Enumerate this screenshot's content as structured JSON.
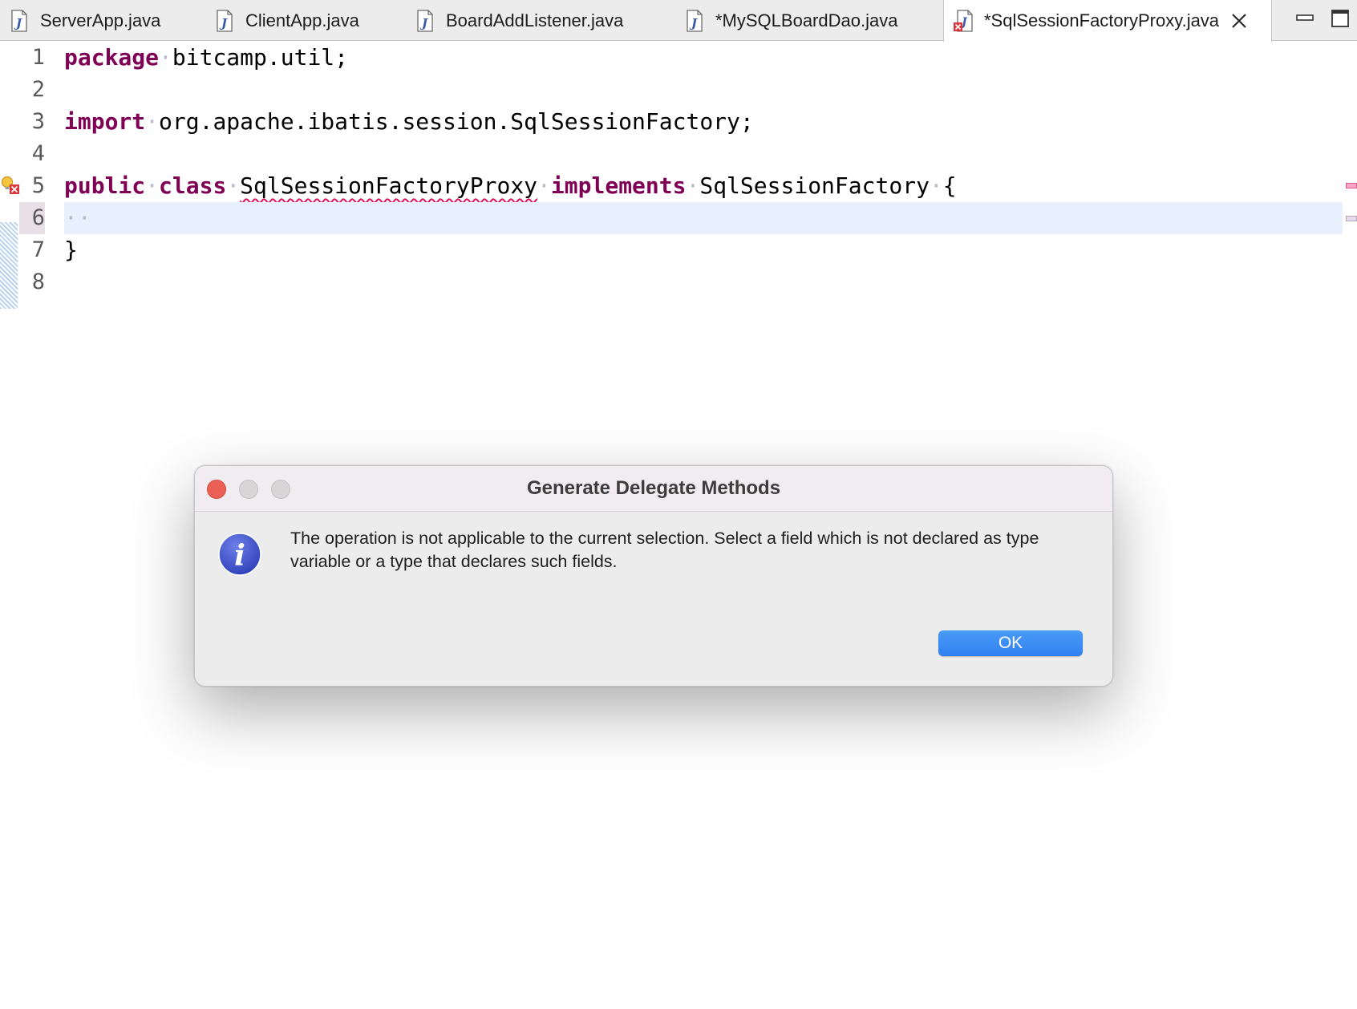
{
  "tabs": [
    {
      "label": "ServerApp.java",
      "icon": "java-file-icon",
      "active": false
    },
    {
      "label": "ClientApp.java",
      "icon": "java-file-icon",
      "active": false
    },
    {
      "label": "BoardAddListener.java",
      "icon": "java-file-icon",
      "active": false
    },
    {
      "label": "*MySQLBoardDao.java",
      "icon": "java-file-icon",
      "active": false
    },
    {
      "label": "*SqlSessionFactoryProxy.java",
      "icon": "java-file-error-icon",
      "active": true
    }
  ],
  "window_controls": {
    "minimize_icon": "minimize-icon",
    "maximize_icon": "maximize-icon"
  },
  "editor": {
    "line_numbers": [
      "1",
      "2",
      "3",
      "4",
      "5",
      "6",
      "7",
      "8"
    ],
    "current_line": "6",
    "lines": {
      "l1": {
        "kw": "package",
        "text": "bitcamp.util;"
      },
      "l3": {
        "kw": "import",
        "text": "org.apache.ibatis.session.SqlSessionFactory;"
      },
      "l5": {
        "kw1": "public",
        "kw2": "class",
        "class_name": "SqlSessionFactoryProxy",
        "kw3": "implements",
        "iface": "SqlSessionFactory",
        "brace": "{"
      },
      "l6": {
        "whitespace": "··"
      },
      "l7": {
        "brace": "}"
      }
    },
    "colors": {
      "keyword": "#7f0055",
      "current_line_bg": "#e8f0fd",
      "error_underline": "#e0115f"
    }
  },
  "dialog": {
    "title": "Generate Delegate Methods",
    "message": "The operation is not applicable to the current selection. Select a field which is not declared as type variable or a type that declares such fields.",
    "icon": "info-icon",
    "ok_label": "OK",
    "accent": "#2f80ef"
  }
}
